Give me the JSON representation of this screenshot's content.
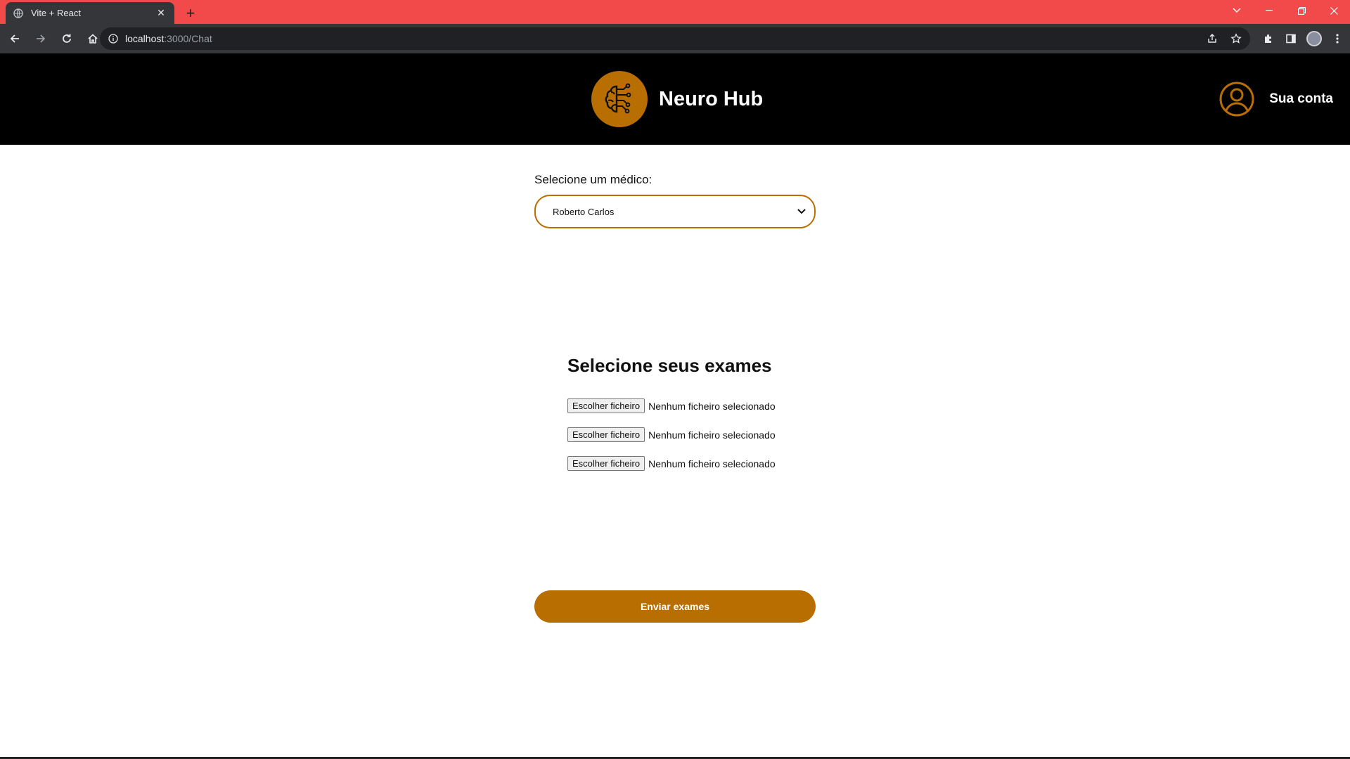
{
  "browser": {
    "tab_title": "Vite + React",
    "url_host": "localhost",
    "url_path": ":3000/Chat"
  },
  "header": {
    "brand_title": "Neuro Hub",
    "account_label": "Sua conta"
  },
  "doctor": {
    "label": "Selecione um médico:",
    "selected": "Roberto Carlos"
  },
  "exams": {
    "title": "Selecione seus exames",
    "inputs": [
      {
        "button": "Escolher ficheiro",
        "status": "Nenhum ficheiro selecionado"
      },
      {
        "button": "Escolher ficheiro",
        "status": "Nenhum ficheiro selecionado"
      },
      {
        "button": "Escolher ficheiro",
        "status": "Nenhum ficheiro selecionado"
      }
    ]
  },
  "actions": {
    "send_label": "Enviar exames"
  },
  "colors": {
    "accent": "#b86e00",
    "header_bg": "#000000",
    "tabbar_bg": "#f24a4b"
  }
}
